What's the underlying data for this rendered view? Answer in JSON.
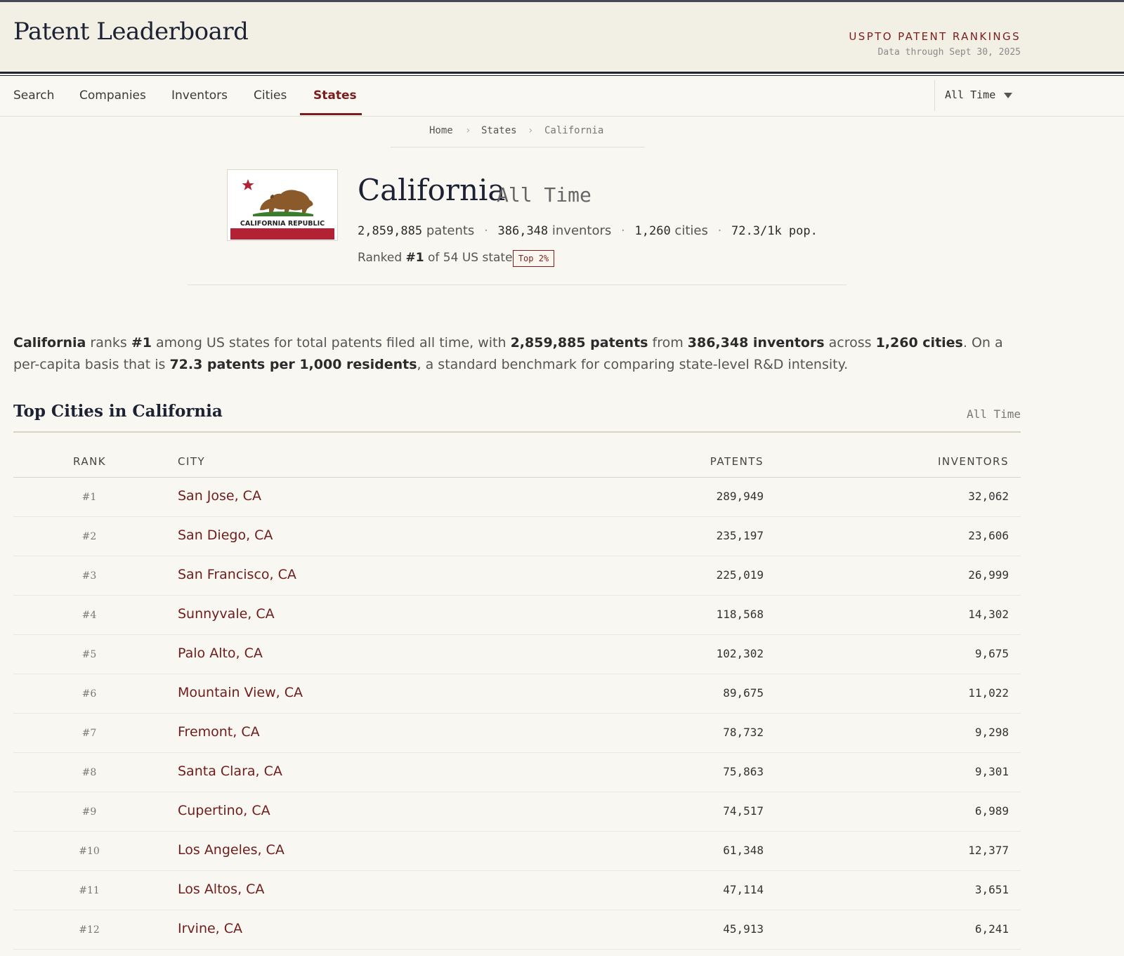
{
  "header": {
    "site_title": "Patent Leaderboard",
    "kicker": "USPTO PATENT RANKINGS",
    "data_through": "Data through Sept 30, 2025"
  },
  "nav": {
    "tabs": [
      {
        "label": "Search"
      },
      {
        "label": "Companies"
      },
      {
        "label": "Inventors"
      },
      {
        "label": "Cities"
      },
      {
        "label": "States"
      }
    ],
    "active_tab": "States",
    "time_select": {
      "value": "All Time"
    }
  },
  "breadcrumb": [
    "Home",
    "States",
    "California"
  ],
  "state": {
    "name": "California",
    "period": "All Time",
    "flag_text": "CALIFORNIA REPUBLIC",
    "stats": {
      "patents": "2,859,885",
      "patents_label": "patents",
      "inventors": "386,348",
      "inventors_label": "inventors",
      "cities": "1,260",
      "cities_label": "cities",
      "per_capita": "72.3/1k pop."
    },
    "rank_prefix": "Ranked ",
    "rank": "#1",
    "rank_suffix": " of 54 US states",
    "badge": "Top 2%"
  },
  "summary": {
    "state": "California",
    "t1": " ranks ",
    "rank": "#1",
    "t2": " among US states for total patents filed all time, with ",
    "patents": "2,859,885 patents",
    "t3": " from ",
    "inventors": "386,348 inventors",
    "t4": " across ",
    "cities": "1,260 cities",
    "t5": ". On a per-capita basis that is ",
    "per_capita": "72.3 patents per 1,000 residents",
    "t6": ", a standard benchmark for comparing state-level R&D intensity."
  },
  "section": {
    "title": "Top Cities in California",
    "period": "All Time"
  },
  "table": {
    "columns": [
      "RANK",
      "CITY",
      "PATENTS",
      "INVENTORS"
    ],
    "rows": [
      {
        "rank": "#1",
        "city": "San Jose, CA",
        "patents": "289,949",
        "inventors": "32,062"
      },
      {
        "rank": "#2",
        "city": "San Diego, CA",
        "patents": "235,197",
        "inventors": "23,606"
      },
      {
        "rank": "#3",
        "city": "San Francisco, CA",
        "patents": "225,019",
        "inventors": "26,999"
      },
      {
        "rank": "#4",
        "city": "Sunnyvale, CA",
        "patents": "118,568",
        "inventors": "14,302"
      },
      {
        "rank": "#5",
        "city": "Palo Alto, CA",
        "patents": "102,302",
        "inventors": "9,675"
      },
      {
        "rank": "#6",
        "city": "Mountain View, CA",
        "patents": "89,675",
        "inventors": "11,022"
      },
      {
        "rank": "#7",
        "city": "Fremont, CA",
        "patents": "78,732",
        "inventors": "9,298"
      },
      {
        "rank": "#8",
        "city": "Santa Clara, CA",
        "patents": "75,863",
        "inventors": "9,301"
      },
      {
        "rank": "#9",
        "city": "Cupertino, CA",
        "patents": "74,517",
        "inventors": "6,989"
      },
      {
        "rank": "#10",
        "city": "Los Angeles, CA",
        "patents": "61,348",
        "inventors": "12,377"
      },
      {
        "rank": "#11",
        "city": "Los Altos, CA",
        "patents": "47,114",
        "inventors": "3,651"
      },
      {
        "rank": "#12",
        "city": "Irvine, CA",
        "patents": "45,913",
        "inventors": "6,241"
      }
    ]
  },
  "colors": {
    "accent": "#7b1d1d",
    "background": "#f9f7f1",
    "header_bg": "#f2efe4",
    "flag_red": "#b22234",
    "bear_brown": "#8b5a2b",
    "grass_green": "#3a7d2c"
  },
  "icons": {
    "caret": "chevron-down-icon",
    "star": "star-icon",
    "bear": "bear-icon"
  }
}
